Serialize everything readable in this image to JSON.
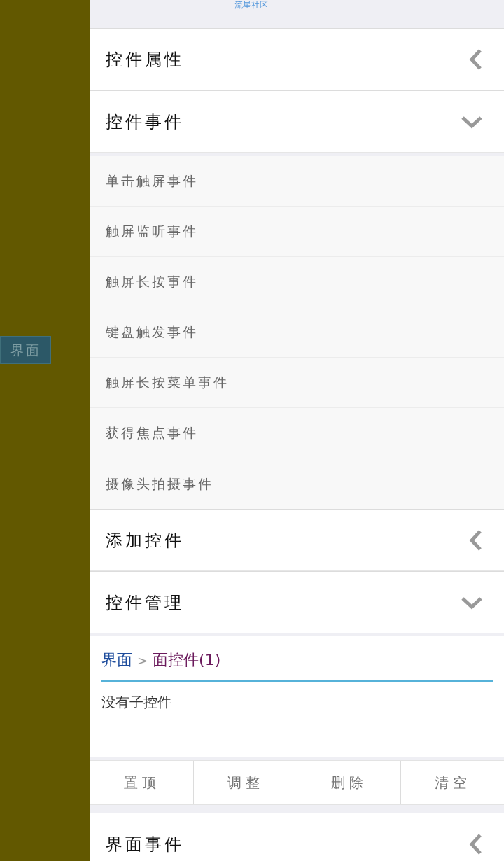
{
  "header": {
    "title": "流星社区"
  },
  "sidebar": {
    "tab": {
      "label": "界面"
    }
  },
  "sections": [
    {
      "title": "控件属性",
      "expanded": false
    },
    {
      "title": "控件事件",
      "expanded": true,
      "kind": "list",
      "items": [
        "单击触屏事件",
        "触屏监听事件",
        "触屏长按事件",
        "键盘触发事件",
        "触屏长按菜单事件",
        "获得焦点事件",
        "摄像头拍摄事件"
      ]
    },
    {
      "title": "添加控件",
      "expanded": false
    },
    {
      "title": "控件管理",
      "expanded": true,
      "kind": "manager",
      "breadcrumb": [
        {
          "label": "界面",
          "current": false
        },
        {
          "label": "面控件(1)",
          "current": true
        }
      ],
      "separator": ">",
      "message": "没有子控件",
      "buttons": [
        "置顶",
        "调整",
        "删除",
        "清空"
      ]
    },
    {
      "title": "界面事件",
      "expanded": false
    }
  ]
}
